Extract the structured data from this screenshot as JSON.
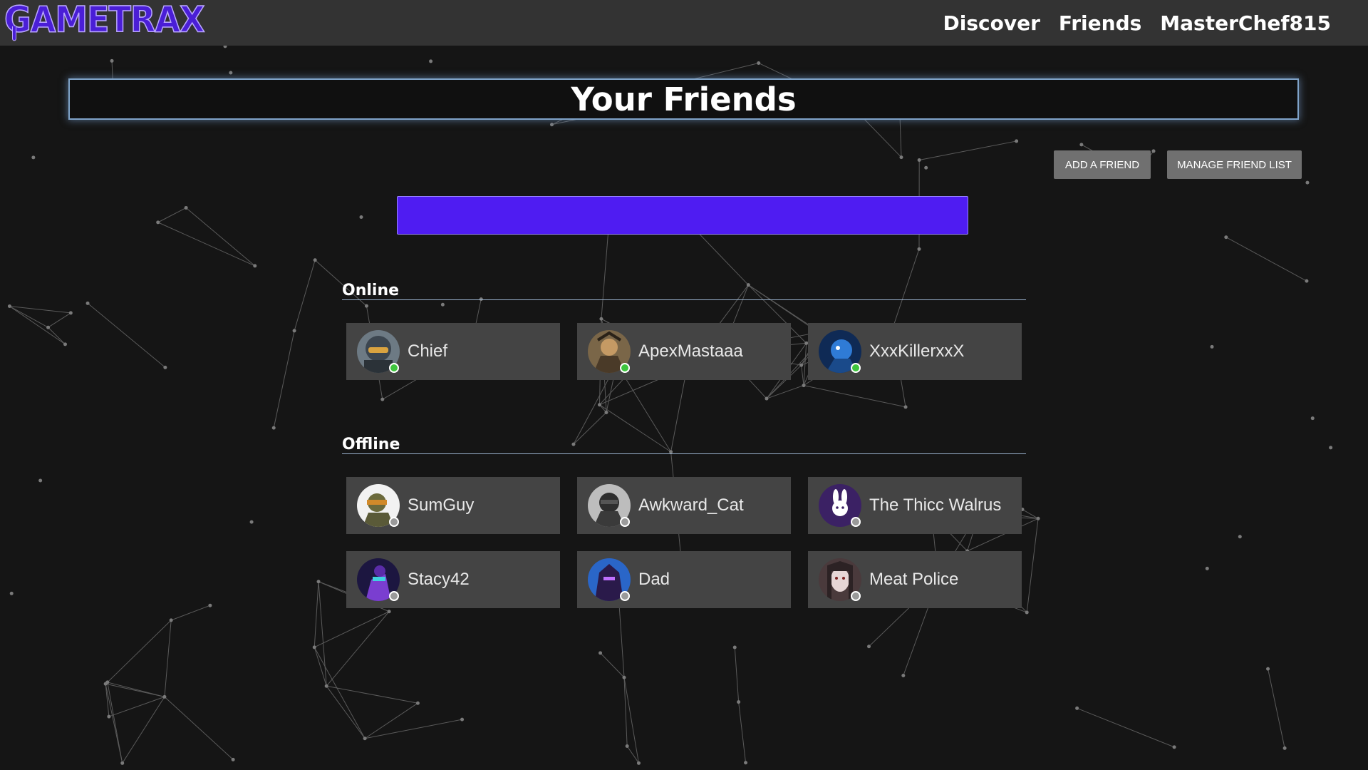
{
  "app": {
    "logo_text": "GAMETRAX"
  },
  "nav": {
    "items": [
      "Discover",
      "Friends",
      "MasterChef815"
    ]
  },
  "page": {
    "title": "Your Friends"
  },
  "buttons": {
    "add_friend": "ADD A FRIEND",
    "manage_list": "MANAGE FRIEND LIST"
  },
  "search": {
    "value": "",
    "placeholder": ""
  },
  "colors": {
    "accent": "#4f1cf2",
    "online": "#3ec53e",
    "offline": "#9a9a9a",
    "card": "#444444",
    "navbar": "#333333"
  },
  "sections": {
    "online": {
      "label": "Online",
      "friends": [
        {
          "name": "Chief",
          "status": "online",
          "avatar": "helmet-avatar"
        },
        {
          "name": "ApexMastaaa",
          "status": "online",
          "avatar": "warrior-avatar"
        },
        {
          "name": "XxxKillerxxX",
          "status": "online",
          "avatar": "blue-creature-avatar"
        }
      ]
    },
    "offline": {
      "label": "Offline",
      "friends": [
        {
          "name": "SumGuy",
          "status": "offline",
          "avatar": "soldier-avatar"
        },
        {
          "name": "Awkward_Cat",
          "status": "offline",
          "avatar": "dark-soldier-avatar"
        },
        {
          "name": "The Thicc Walrus",
          "status": "offline",
          "avatar": "bunny-avatar"
        },
        {
          "name": "Stacy42",
          "status": "offline",
          "avatar": "purple-hero-avatar"
        },
        {
          "name": "Dad",
          "status": "offline",
          "avatar": "hooded-figure-avatar"
        },
        {
          "name": "Meat Police",
          "status": "offline",
          "avatar": "pale-face-avatar"
        }
      ]
    }
  }
}
